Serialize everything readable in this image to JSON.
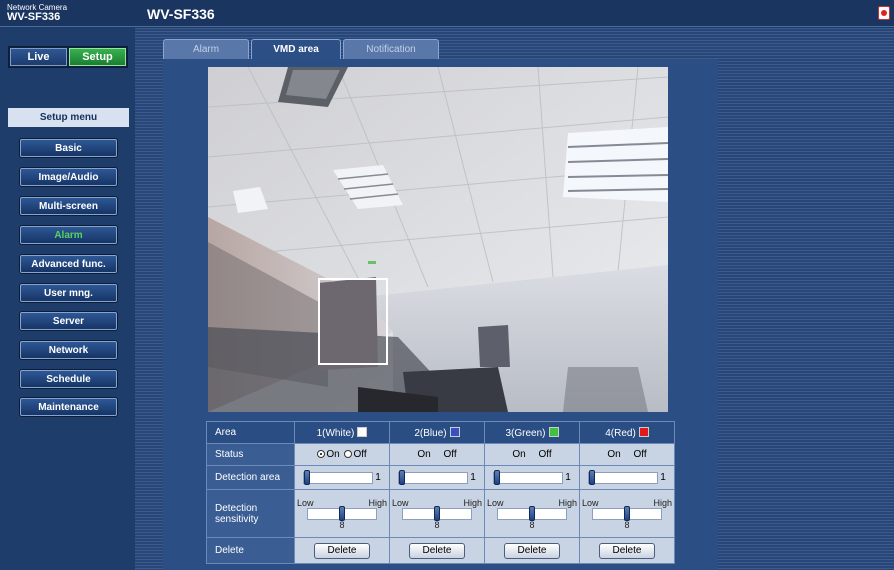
{
  "header": {
    "brand_small": "Network Camera",
    "brand_model": "WV-SF336",
    "page_title": "WV-SF336",
    "help_icon": "help-icon"
  },
  "mode": {
    "live_label": "Live",
    "setup_label": "Setup",
    "selected": "Setup"
  },
  "sidebar": {
    "title": "Setup menu",
    "items": [
      {
        "label": "Basic"
      },
      {
        "label": "Image/Audio"
      },
      {
        "label": "Multi-screen"
      },
      {
        "label": "Alarm",
        "active": true
      },
      {
        "label": "Advanced func."
      },
      {
        "label": "User mng."
      },
      {
        "label": "Server"
      },
      {
        "label": "Network"
      },
      {
        "label": "Schedule"
      },
      {
        "label": "Maintenance"
      }
    ]
  },
  "tabs": [
    {
      "label": "Alarm",
      "active": false
    },
    {
      "label": "VMD area",
      "active": true
    },
    {
      "label": "Notification",
      "active": false
    }
  ],
  "table": {
    "header_area": "Area",
    "areas": [
      {
        "label": "1(White)",
        "color": "#ffffff"
      },
      {
        "label": "2(Blue)",
        "color": "#3a4fc0"
      },
      {
        "label": "3(Green)",
        "color": "#3fc23f"
      },
      {
        "label": "4(Red)",
        "color": "#e01b1b"
      }
    ],
    "status_label": "Status",
    "on_label": "On",
    "off_label": "Off",
    "status_values": [
      "On",
      "Off",
      "Off",
      "Off"
    ],
    "detection_area_label": "Detection area",
    "detection_area_values": [
      "1",
      "1",
      "1",
      "1"
    ],
    "sensitivity_label_line1": "Detection",
    "sensitivity_label_line2": "sensitivity",
    "low_label": "Low",
    "high_label": "High",
    "sensitivity_values": [
      "8",
      "8",
      "8",
      "8"
    ],
    "sensitivity_level": 0.5,
    "delete_row_label": "Delete",
    "delete_button_label": "Delete"
  }
}
